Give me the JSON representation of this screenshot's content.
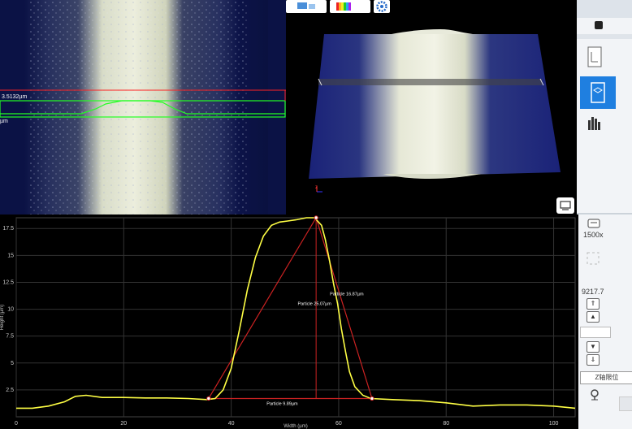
{
  "left_view": {
    "measure_value": "3.5132µm",
    "measure_unit": "µm"
  },
  "toolbar3d": {
    "icons": [
      "view-mode-icon",
      "color-map-icon",
      "settings-icon"
    ]
  },
  "sidebar": {
    "zoom_label": "1500x",
    "z_value": "9217.7",
    "z_reset_button": "Z轴限位"
  },
  "chart_data": {
    "type": "line",
    "xlabel": "Width (µm)",
    "ylabel": "Height (µm)",
    "xlim": [
      0,
      104
    ],
    "ylim": [
      0,
      18.5
    ],
    "x_ticks": [
      "0",
      "20",
      "40",
      "60",
      "80",
      "100"
    ],
    "y_ticks": [
      "2.5",
      "5",
      "7.5",
      "10",
      "12.5",
      "15",
      "17.5"
    ],
    "grid": true,
    "line_color": "#ffff44",
    "marker_color": "#cc2222",
    "series": [
      {
        "x": [
          0,
          3,
          6,
          9,
          11,
          13,
          16,
          20,
          24,
          28,
          32,
          35.5,
          37,
          38.5,
          40,
          41.5,
          43,
          44.5,
          46,
          47.5,
          49,
          50.5,
          52,
          54,
          55.5,
          56.8,
          57.5,
          58.3,
          59,
          59.8,
          60.5,
          61.3,
          62,
          63,
          64.5,
          66,
          70,
          75,
          80,
          85,
          90,
          95,
          100,
          104
        ],
        "y": [
          0.8,
          0.8,
          1.0,
          1.4,
          1.9,
          2.0,
          1.8,
          1.8,
          1.75,
          1.75,
          1.7,
          1.6,
          1.7,
          2.5,
          4.5,
          8.0,
          11.8,
          14.8,
          16.8,
          17.8,
          18.1,
          18.2,
          18.3,
          18.5,
          18.5,
          17.8,
          16.5,
          14.5,
          12.5,
          10.5,
          8.2,
          6.0,
          4.2,
          2.8,
          2.0,
          1.7,
          1.6,
          1.5,
          1.3,
          1.0,
          1.1,
          1.1,
          1.0,
          0.8
        ]
      }
    ],
    "annotations": [
      {
        "label": "Particle 25.07µm",
        "x": 55.5,
        "y": 10.4
      },
      {
        "label": "Particle 16.87µm",
        "x": 61.5,
        "y": 11.3
      },
      {
        "label": "Particle 9.89µm",
        "x": 49.5,
        "y": 1.1
      }
    ],
    "measure_points": [
      [
        35.8,
        1.7
      ],
      [
        55.8,
        18.5
      ],
      [
        66.2,
        1.7
      ]
    ]
  }
}
